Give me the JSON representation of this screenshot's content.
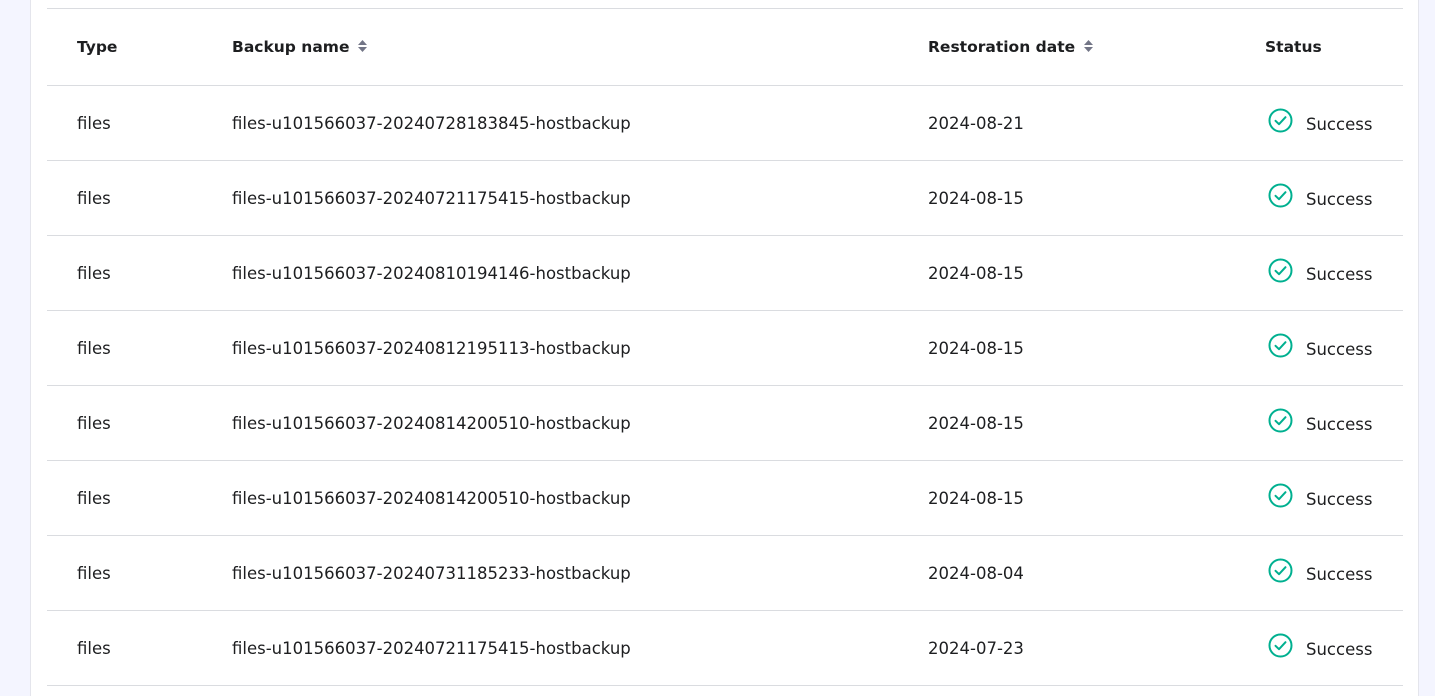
{
  "table": {
    "headers": {
      "type": "Type",
      "backup_name": "Backup name",
      "restoration_date": "Restoration date",
      "status": "Status"
    },
    "sort_icon": "sort-updown-icon",
    "status_icon": "check-circle-icon",
    "colors": {
      "success": "#00b090",
      "divider": "#dadce0",
      "sort_icon": "#727586"
    },
    "rows": [
      {
        "type": "files",
        "name": "files-u101566037-20240728183845-hostbackup",
        "date": "2024-08-21",
        "status": "Success"
      },
      {
        "type": "files",
        "name": "files-u101566037-20240721175415-hostbackup",
        "date": "2024-08-15",
        "status": "Success"
      },
      {
        "type": "files",
        "name": "files-u101566037-20240810194146-hostbackup",
        "date": "2024-08-15",
        "status": "Success"
      },
      {
        "type": "files",
        "name": "files-u101566037-20240812195113-hostbackup",
        "date": "2024-08-15",
        "status": "Success"
      },
      {
        "type": "files",
        "name": "files-u101566037-20240814200510-hostbackup",
        "date": "2024-08-15",
        "status": "Success"
      },
      {
        "type": "files",
        "name": "files-u101566037-20240814200510-hostbackup",
        "date": "2024-08-15",
        "status": "Success"
      },
      {
        "type": "files",
        "name": "files-u101566037-20240731185233-hostbackup",
        "date": "2024-08-04",
        "status": "Success"
      },
      {
        "type": "files",
        "name": "files-u101566037-20240721175415-hostbackup",
        "date": "2024-07-23",
        "status": "Success"
      }
    ]
  }
}
